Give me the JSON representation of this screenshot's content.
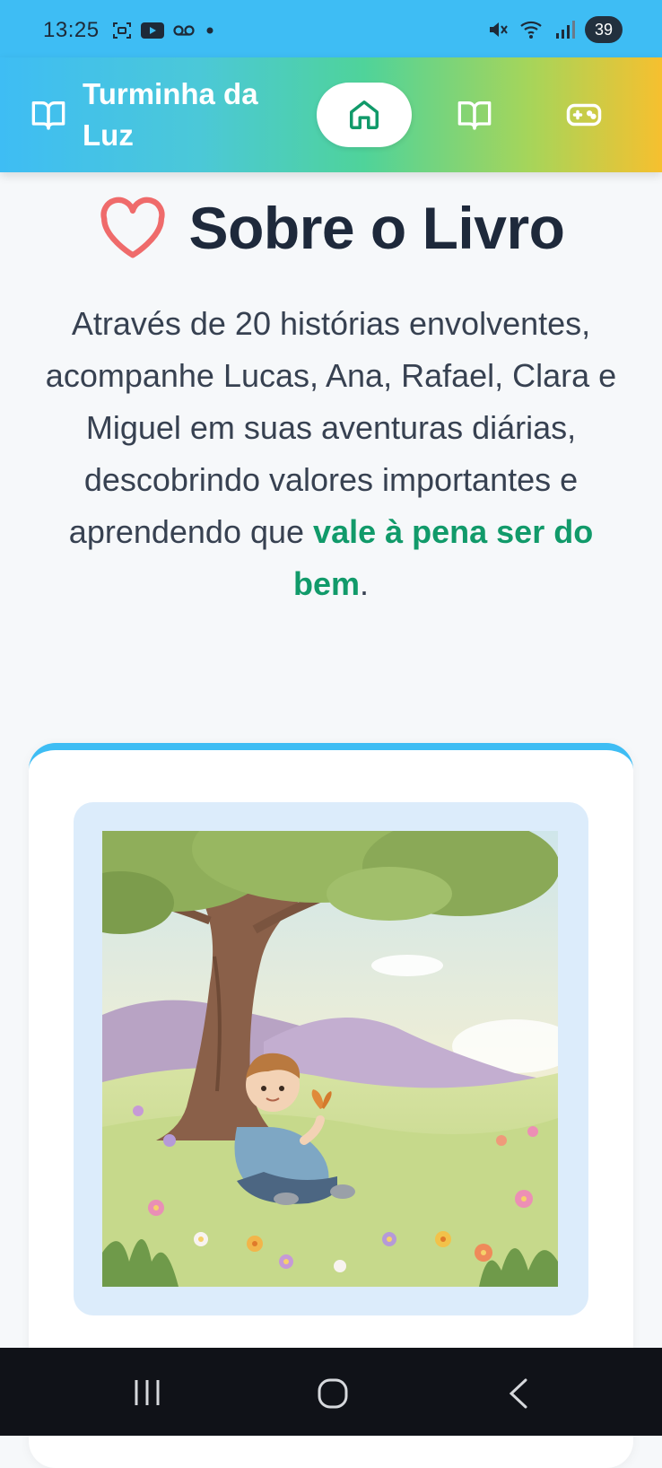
{
  "status_bar": {
    "time": "13:25",
    "battery": "39",
    "icons": [
      "screenshot-icon",
      "youtube-icon",
      "voicemail-icon",
      "dot-icon",
      "mute-icon",
      "wifi-icon",
      "signal-icon"
    ]
  },
  "header": {
    "title": "Turminha da Luz",
    "nav": [
      {
        "icon": "home-icon",
        "active": true
      },
      {
        "icon": "book-icon",
        "active": false
      },
      {
        "icon": "gamepad-icon",
        "active": false
      }
    ]
  },
  "about": {
    "icon": "heart-icon",
    "title": "Sobre o Livro",
    "text_before": "Através de 20 histórias envolventes, acompanhe Lucas, Ana, Rafael, Clara e Miguel em suas aventuras diárias, descobrindo valores importantes e aprendendo que ",
    "text_highlight": "vale à pena ser do bem",
    "text_after": "."
  },
  "card": {
    "image_subject": "boy-under-tree-with-butterfly"
  },
  "colors": {
    "accent_blue": "#3ebdf4",
    "accent_green": "#119a6a",
    "heart": "#ef6b6b",
    "title": "#1e293b"
  },
  "navigation_bar": {
    "icons": [
      "recents-icon",
      "home-circle-icon",
      "back-icon"
    ]
  }
}
